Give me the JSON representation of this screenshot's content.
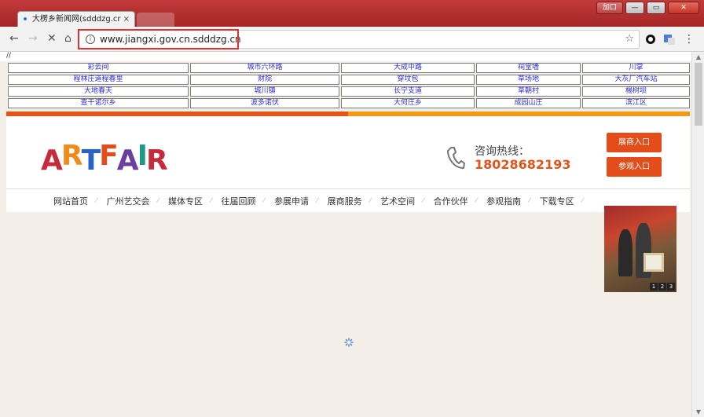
{
  "browser": {
    "tab_title": "大楞乡新闻网(sdddzg.cr",
    "tab_close": "×",
    "url": "www.jiangxi.gov.cn.sdddzg.cn",
    "window_user": "加口"
  },
  "page": {
    "top_text": "//",
    "link_rows": [
      [
        "彩云间",
        "城市六环路",
        "大成中路",
        "祠堂墙",
        "川掌"
      ],
      [
        "程林庄道程春里",
        "财院",
        "穿坟包",
        "草场地",
        "大灰厂汽车站"
      ],
      [
        "大地春天",
        "城川镇",
        "长宁支道",
        "草朝村",
        "楊树坝"
      ],
      [
        "查干诺尔乡",
        "波多诺伏",
        "大何庄乡",
        "成园山庄",
        "滨江区"
      ]
    ],
    "logo_letters": [
      "A",
      "R",
      "T",
      "F",
      "A",
      "I",
      "R"
    ],
    "hotline_label": "咨询热线：",
    "hotline_number": "18028682193",
    "exhibitor_button": "展商入口",
    "visitor_button": "参观入口",
    "nav": [
      "网站首页",
      "广州艺交会",
      "媒体专区",
      "往届回顾",
      "参展申请",
      "展商服务",
      "艺术空间",
      "合作伙伴",
      "参观指南",
      "下载专区"
    ],
    "pager": [
      "1",
      "2",
      "3"
    ]
  },
  "colors": {
    "accent": "#e24d1a",
    "orange": "#f19a1a",
    "link": "#2b2bd6"
  }
}
